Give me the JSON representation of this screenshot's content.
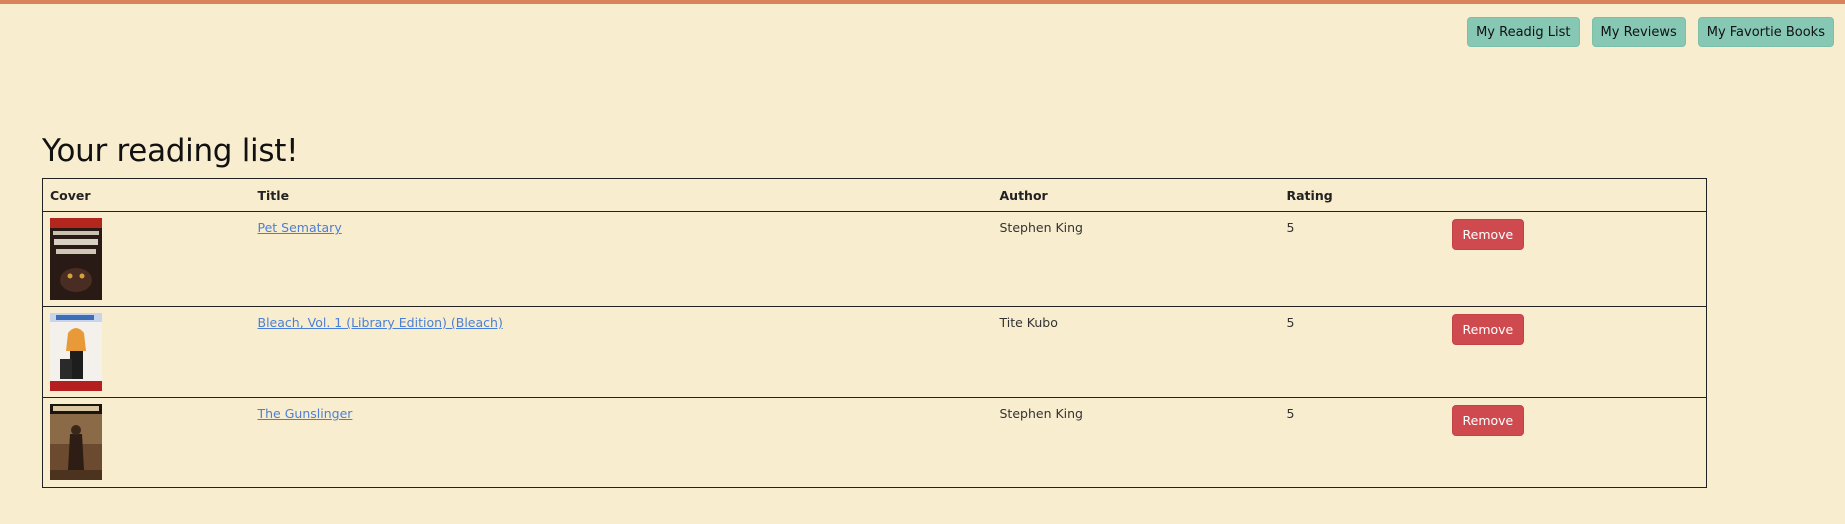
{
  "nav": {
    "reading_list": "My Readig List",
    "reviews": "My Reviews",
    "favorite_books": "My Favortie Books"
  },
  "heading": "Your reading list!",
  "table": {
    "headers": {
      "cover": "Cover",
      "title": "Title",
      "author": "Author",
      "rating": "Rating"
    },
    "rows": [
      {
        "cover": "pet-sematary-cover",
        "title": "Pet Sematary",
        "author": "Stephen King",
        "rating": "5",
        "action": "Remove"
      },
      {
        "cover": "bleach-cover",
        "title": "Bleach, Vol. 1 (Library Edition) (Bleach)",
        "author": "Tite Kubo",
        "rating": "5",
        "action": "Remove"
      },
      {
        "cover": "gunslinger-cover",
        "title": "The Gunslinger",
        "author": "Stephen King",
        "rating": "5",
        "action": "Remove"
      }
    ]
  },
  "colors": {
    "background": "#f9edcf",
    "accent_strip": "#d9825b",
    "nav_button": "#86c8b4",
    "remove_button": "#cf4a4e",
    "link": "#4a7fd6"
  }
}
